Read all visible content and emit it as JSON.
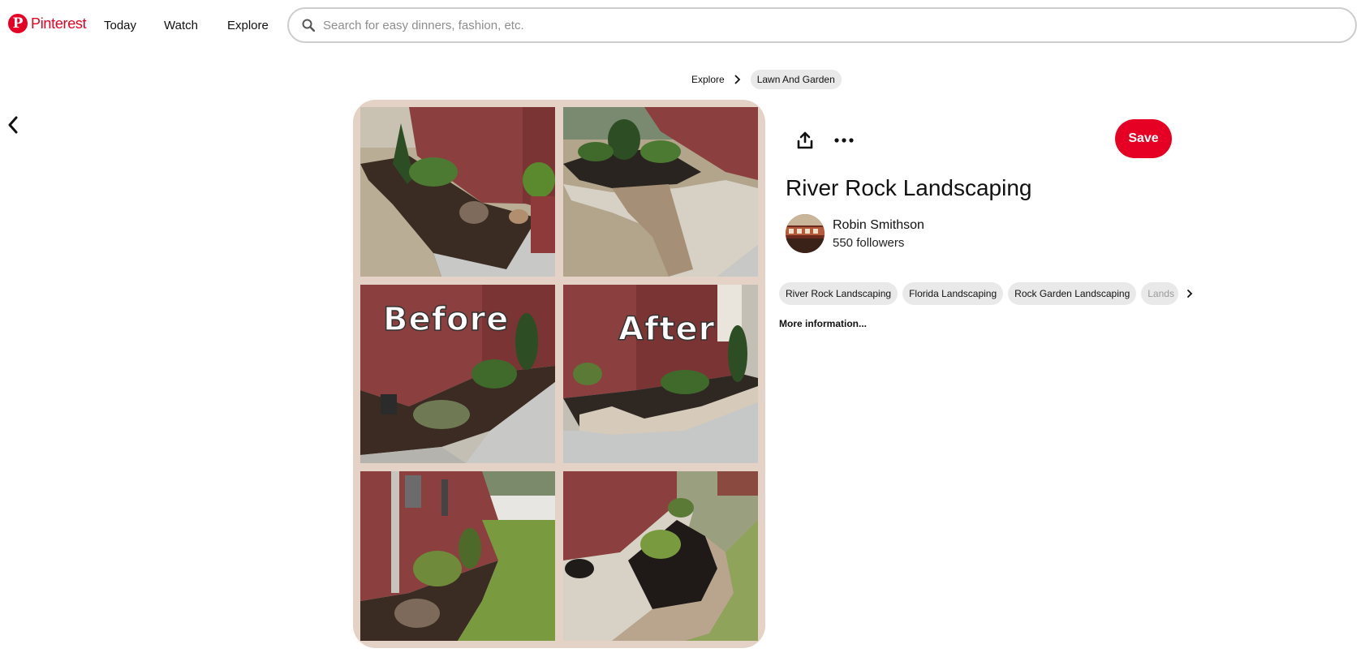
{
  "brand": {
    "name": "Pinterest",
    "color": "#e60023"
  },
  "nav": {
    "today": "Today",
    "watch": "Watch",
    "explore": "Explore"
  },
  "search": {
    "placeholder": "Search for easy dinners, fashion, etc."
  },
  "breadcrumb": {
    "items": [
      "Explore",
      "Lawn And Garden"
    ]
  },
  "pin": {
    "title": "River Rock Landscaping",
    "save_label": "Save",
    "image_labels": {
      "before": "Before",
      "after": "After"
    },
    "creator": {
      "name": "Robin Smithson",
      "followers": "550 followers"
    },
    "tags": [
      "River Rock Landscaping",
      "Florida Landscaping",
      "Rock Garden Landscaping",
      "Lands"
    ],
    "more_info": "More information..."
  },
  "icons": {
    "logo": "pinterest-logo-icon",
    "search": "search-icon",
    "breadcrumb_sep": "chevron-right-icon",
    "back": "chevron-left-icon",
    "share": "share-icon",
    "more": "ellipsis-icon",
    "tags_next": "chevron-right-icon"
  }
}
